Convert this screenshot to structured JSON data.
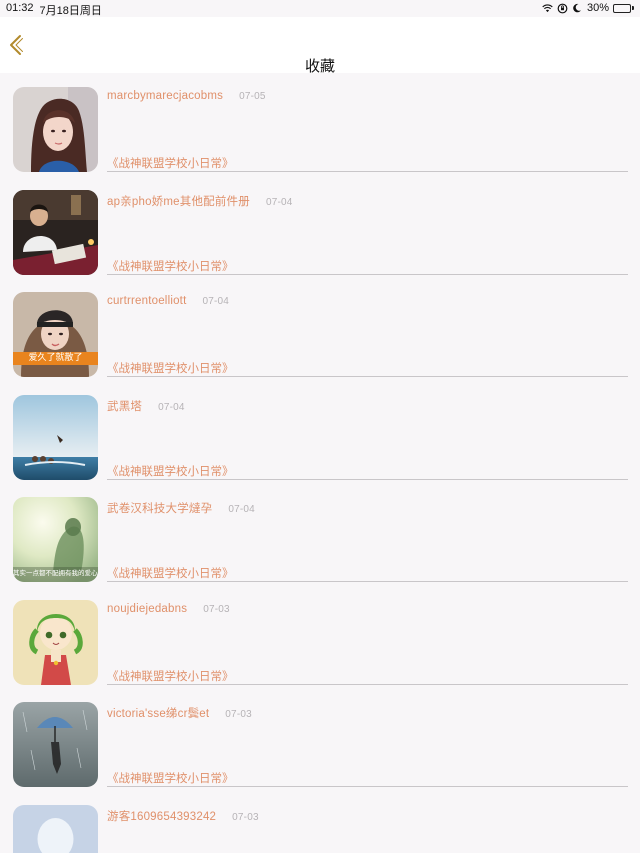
{
  "status": {
    "time": "01:32",
    "date": "7月18日周日",
    "battery_text": "30%",
    "battery_level": 0.3,
    "icons": [
      "wifi-icon",
      "orientation-lock-icon",
      "moon-icon",
      "battery-icon"
    ]
  },
  "nav": {
    "back_icon": "chevron-left-icon",
    "title": "收藏"
  },
  "colors": {
    "accent": "#e0906a",
    "back_icon": "#b28a2c",
    "muted": "#b6b3b6"
  },
  "items": [
    {
      "user": "marcbymarecjacobms",
      "date": "07-05",
      "book": "《战神联盟学校小日常》",
      "avatar": "girl-portrait"
    },
    {
      "user": "ap亲pho娇me其他配前件册",
      "date": "07-04",
      "book": "《战神联盟学校小日常》",
      "avatar": "restaurant-photo"
    },
    {
      "user": "curtrrentoelliott",
      "date": "07-04",
      "book": "《战神联盟学校小日常》",
      "avatar": "girl-with-hat",
      "avatar_caption": "爱久了就散了"
    },
    {
      "user": "武黑塔",
      "date": "07-04",
      "book": "《战神联盟学校小日常》",
      "avatar": "sea-photo"
    },
    {
      "user": "武卷汉科技大学燵孕",
      "date": "07-04",
      "book": "《战神联盟学校小日常》",
      "avatar": "soft-light-photo",
      "avatar_caption": "其实一点都不配拥有我的爱心"
    },
    {
      "user": "noujdiejedabns",
      "date": "07-03",
      "book": "《战神联盟学校小日常》",
      "avatar": "anime-girl"
    },
    {
      "user": "victoria'sse绨cr鬓et",
      "date": "07-03",
      "book": "《战神联盟学校小日常》",
      "avatar": "rain-umbrella"
    },
    {
      "user": "游客1609654393242",
      "date": "07-03",
      "book": "",
      "avatar": "default-avatar"
    }
  ]
}
